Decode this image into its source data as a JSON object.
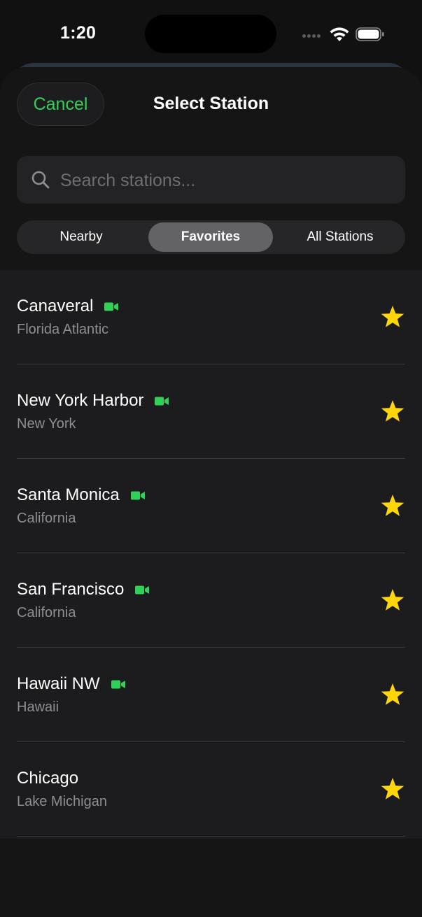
{
  "status_bar": {
    "time": "1:20",
    "icons": [
      "cellular-dots-icon",
      "wifi-icon",
      "battery-icon"
    ]
  },
  "header": {
    "cancel_label": "Cancel",
    "title": "Select Station"
  },
  "search": {
    "placeholder": "Search stations...",
    "value": ""
  },
  "tabs": [
    {
      "label": "Nearby",
      "selected": false
    },
    {
      "label": "Favorites",
      "selected": true
    },
    {
      "label": "All Stations",
      "selected": false
    }
  ],
  "stations": [
    {
      "name": "Canaveral",
      "region": "Florida Atlantic",
      "has_camera": true,
      "favorite": true
    },
    {
      "name": "New York Harbor",
      "region": "New York",
      "has_camera": true,
      "favorite": true
    },
    {
      "name": "Santa Monica",
      "region": "California",
      "has_camera": true,
      "favorite": true
    },
    {
      "name": "San Francisco",
      "region": "California",
      "has_camera": true,
      "favorite": true
    },
    {
      "name": "Hawaii NW",
      "region": "Hawaii",
      "has_camera": true,
      "favorite": true
    },
    {
      "name": "Chicago",
      "region": "Lake Michigan",
      "has_camera": false,
      "favorite": true
    }
  ],
  "colors": {
    "accent_green": "#30d158",
    "star_yellow": "#ffd60a",
    "background": "#111111",
    "list_background": "#1c1c1e",
    "secondary_text": "#8e8e93"
  }
}
